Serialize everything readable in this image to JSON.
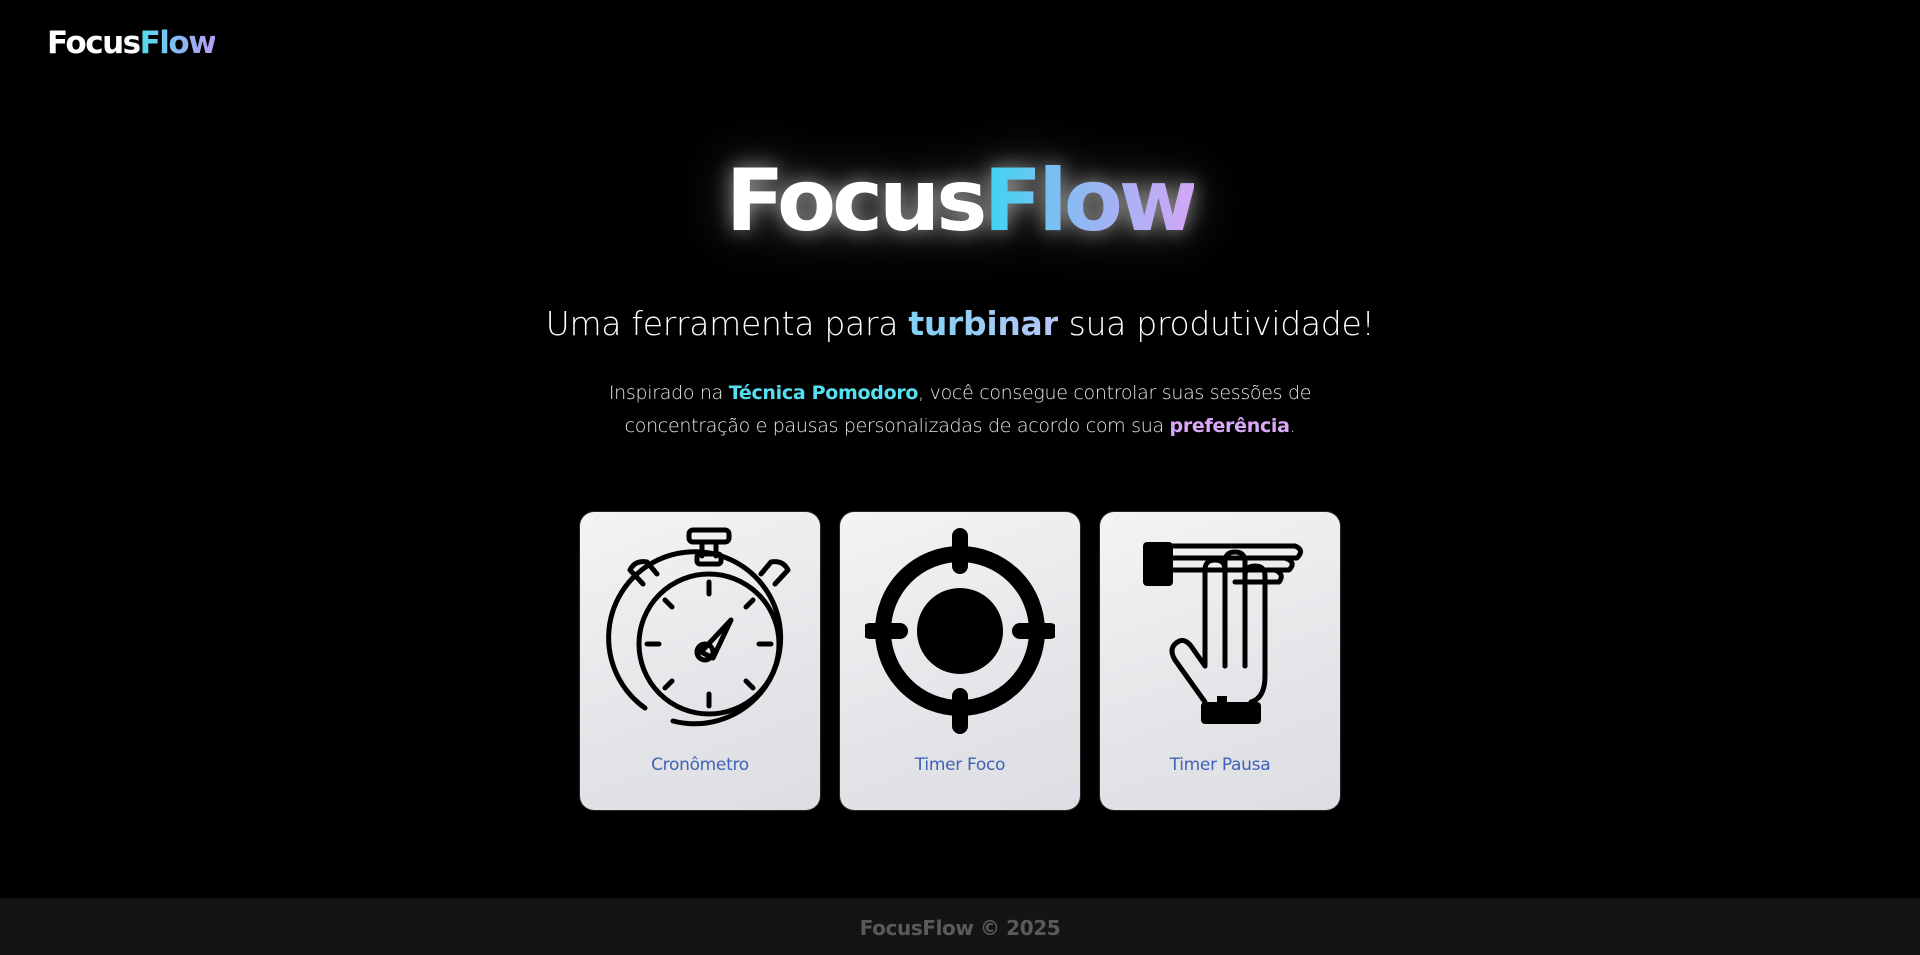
{
  "header": {
    "logo_part1": "Focus",
    "logo_part2": "Flow"
  },
  "hero": {
    "title_part1": "Focus",
    "title_part2": "Flow",
    "subtitle_before": "Uma ferramenta para ",
    "subtitle_highlight": "turbinar",
    "subtitle_after": " sua produtividade!",
    "desc_before": "Inspirado na ",
    "desc_highlight1": "Técnica Pomodoro",
    "desc_middle": ", você consegue controlar suas sessões de concentração e pausas personalizadas de acordo com sua ",
    "desc_highlight2": "preferência",
    "desc_after": "."
  },
  "cards": [
    {
      "label": "Cronômetro",
      "icon": "stopwatch-icon"
    },
    {
      "label": "Timer Foco",
      "icon": "crosshair-target-icon"
    },
    {
      "label": "Timer Pausa",
      "icon": "hand-stop-icon"
    }
  ],
  "footer": {
    "text": "FocusFlow © 2025"
  },
  "colors": {
    "background": "#000000",
    "accent_cyan": "#54e0f0",
    "accent_purple": "#dba7fb",
    "card_label": "#3f62b8",
    "footer_bg": "#141414",
    "footer_text": "#5a5a5a"
  }
}
